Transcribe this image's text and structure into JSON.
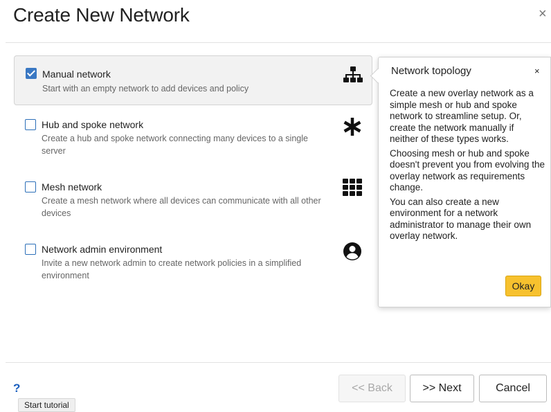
{
  "dialog": {
    "title": "Create New Network",
    "close_symbol": "×"
  },
  "options": [
    {
      "label": "Manual network",
      "description": "Start with an empty network to add devices and policy",
      "checked": true,
      "icon": "network-topology-icon"
    },
    {
      "label": "Hub and spoke network",
      "description": "Create a hub and spoke network connecting many devices to a single server",
      "checked": false,
      "icon": "asterisk-icon"
    },
    {
      "label": "Mesh network",
      "description": "Create a mesh network where all devices can communicate with all other devices",
      "checked": false,
      "icon": "grid-icon"
    },
    {
      "label": "Network admin environment",
      "description": "Invite a new network admin to create network policies in a simplified environment",
      "checked": false,
      "icon": "user-circle-icon"
    }
  ],
  "popover": {
    "title": "Network topology",
    "close_symbol": "×",
    "paragraphs": [
      "Create a new overlay network as a simple mesh or hub and spoke network to streamline setup. Or, create the network manually if neither of these types works.",
      "Choosing mesh or hub and spoke doesn't prevent you from evolving the overlay network as requirements change.",
      "You can also create a new environment for a network administrator to manage their own overlay network."
    ],
    "okay_label": "Okay"
  },
  "footer": {
    "help_symbol": "?",
    "tooltip": "Start tutorial",
    "back_label": "<< Back",
    "next_label": ">> Next",
    "cancel_label": "Cancel"
  },
  "colors": {
    "accent": "#3a78c3",
    "okay_button": "#f7c12e",
    "help": "#1a5fbf"
  }
}
